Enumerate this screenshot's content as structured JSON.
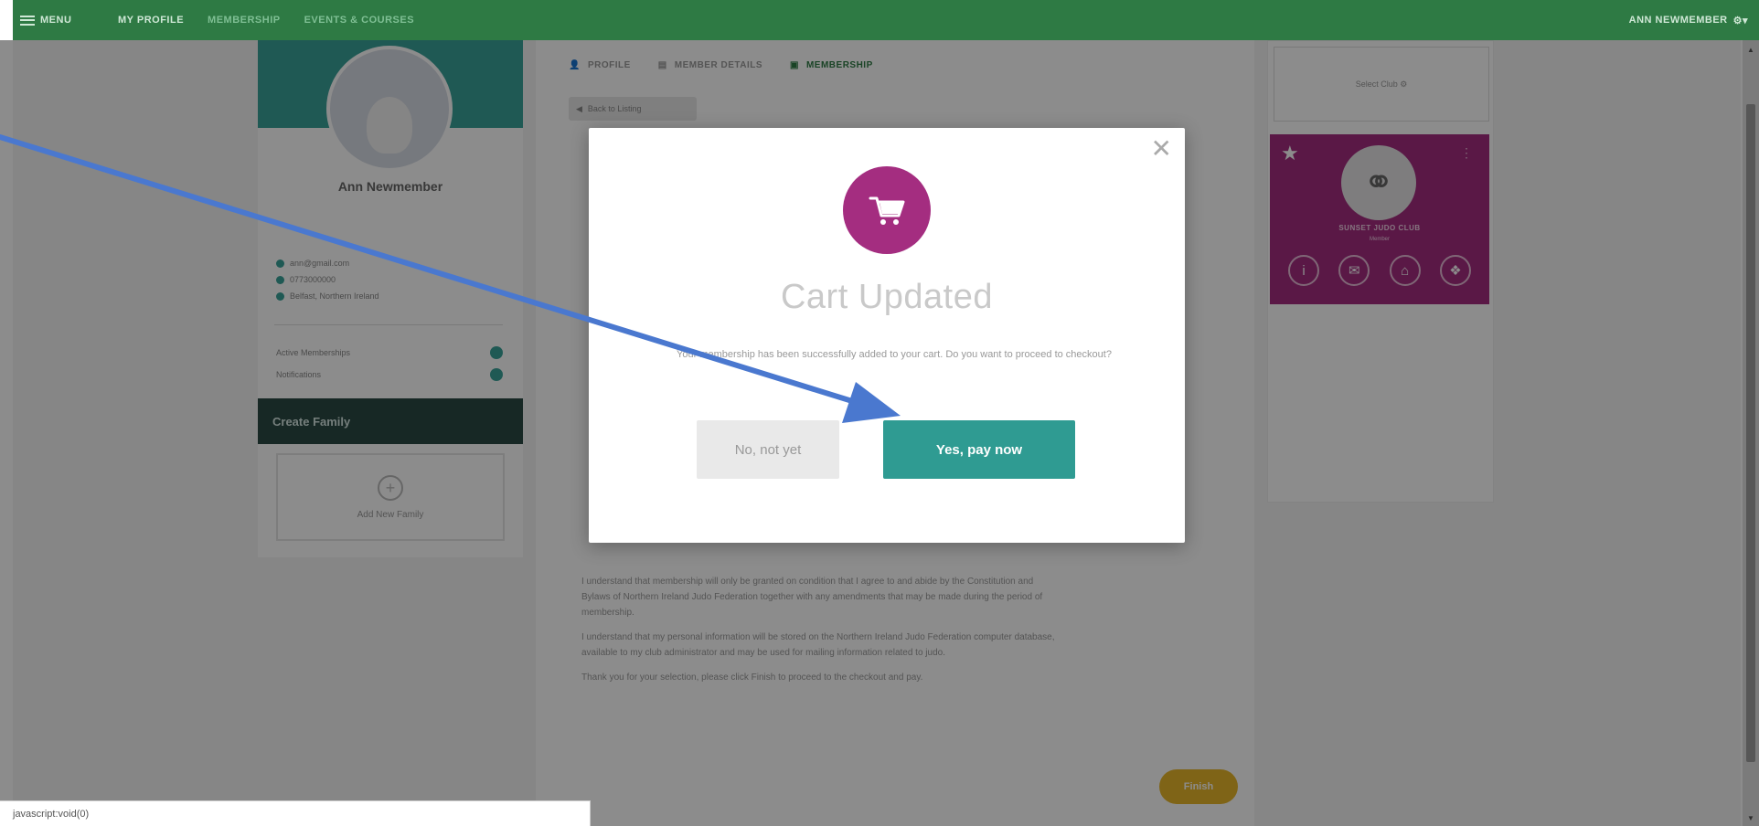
{
  "nav": {
    "menu_label": "MENU",
    "links": [
      "MY PROFILE",
      "MEMBERSHIP",
      "EVENTS & COURSES"
    ],
    "user_label": "ANN NEWMEMBER"
  },
  "profile": {
    "name": "Ann Newmember",
    "email": "ann@gmail.com",
    "phone": "0773000000",
    "address": "Belfast, Northern Ireland",
    "active_memberships_label": "Active Memberships",
    "notifications_label": "Notifications",
    "create_family_label": "Create Family",
    "add_family_label": "Add New Family"
  },
  "tabs": [
    "PROFILE",
    "MEMBER DETAILS",
    "MEMBERSHIP"
  ],
  "back_label": "Back to Listing",
  "terms": [
    "I understand that membership will only be granted on condition that I agree to and abide by the Constitution and Bylaws of Northern Ireland Judo Federation together with any amendments that may be made during the period of membership.",
    "I understand that my personal information will be stored on the Northern Ireland Judo Federation computer database, available to my club administrator and may be used for mailing information related to judo.",
    "Thank you for your selection, please click Finish to proceed to the checkout and pay."
  ],
  "finish_label": "Finish",
  "right": {
    "select_club_label": "Select Club",
    "club_name": "SUNSET JUDO CLUB",
    "club_sub": "Member"
  },
  "modal": {
    "title": "Cart Updated",
    "message": "Your membership has been successfully added to your cart. Do you want to proceed to checkout?",
    "no_label": "No, not yet",
    "yes_label": "Yes, pay now",
    "accent": "#a42d80",
    "primary": "#2f9b92"
  },
  "status_bar": "javascript:void(0)"
}
